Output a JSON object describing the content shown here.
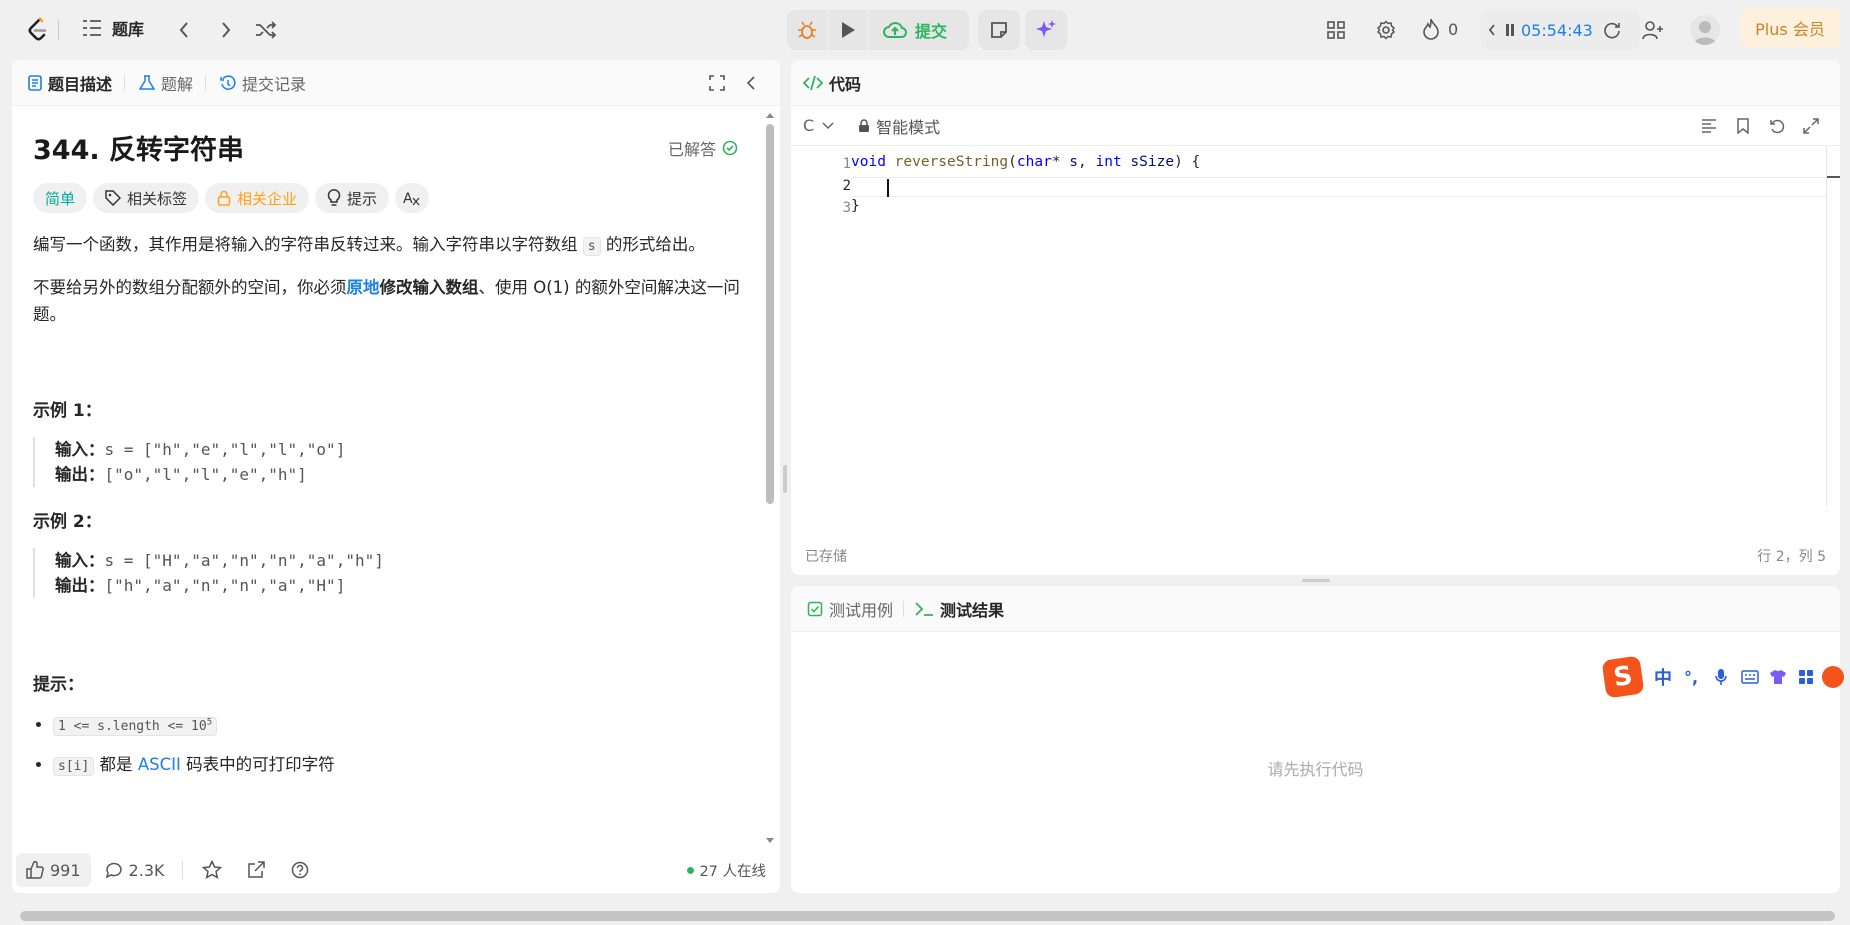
{
  "topbar": {
    "problem_list_label": "题库",
    "submit_label": "提交",
    "streak_count": "0",
    "timer": "05:54:43",
    "plus_label": "Plus 会员"
  },
  "left_panel": {
    "tabs": [
      {
        "label": "题目描述"
      },
      {
        "label": "题解"
      },
      {
        "label": "提交记录"
      }
    ],
    "problem_title": "344. 反转字符串",
    "solved_label": "已解答",
    "tags": {
      "difficulty": "简单",
      "related_tags": "相关标签",
      "related_companies": "相关企业",
      "hint": "提示"
    },
    "desc1_a": "编写一个函数，其作用是将输入的字符串反转过来。输入字符串以字符数组 ",
    "desc1_code": "s",
    "desc1_b": " 的形式给出。",
    "desc2_a": "不要给另外的数组分配额外的空间，你必须",
    "desc2_link": "原地",
    "desc2_bold": "修改输入数组",
    "desc2_b": "、使用 O(1) 的额外空间解决这一问题。",
    "example1_title": "示例 1：",
    "example1_input_label": "输入：",
    "example1_input": "s = [\"h\",\"e\",\"l\",\"l\",\"o\"]",
    "example1_output_label": "输出：",
    "example1_output": "[\"o\",\"l\",\"l\",\"e\",\"h\"]",
    "example2_title": "示例 2：",
    "example2_input_label": "输入：",
    "example2_input": "s = [\"H\",\"a\",\"n\",\"n\",\"a\",\"h\"]",
    "example2_output_label": "输出：",
    "example2_output": "[\"h\",\"a\",\"n\",\"n\",\"a\",\"H\"]",
    "constraints_title": "提示：",
    "constraint1_code": "1 <= s.length <= 10",
    "constraint1_sup": "5",
    "constraint2_code": "s[i]",
    "constraint2_a": " 都是 ",
    "constraint2_link": "ASCII",
    "constraint2_b": " 码表中的可打印字符",
    "footer": {
      "likes": "991",
      "comments": "2.3K",
      "online": "27 人在线"
    }
  },
  "code_panel": {
    "title": "代码",
    "language": "C",
    "mode_label": "智能模式",
    "line_numbers": [
      "1",
      "2",
      "3"
    ],
    "code_line1": {
      "kw": "void",
      "fn": "reverseString",
      "p1": "(",
      "ty1": "char",
      "star": "* ",
      "a1": "s",
      "comma": ", ",
      "ty2": "int",
      "a2": " sSize",
      "p2": ") {"
    },
    "code_line3": "}",
    "saved_label": "已存储",
    "cursor_pos": "行 2，列 5"
  },
  "test_panel": {
    "tabs": [
      {
        "label": "测试用例"
      },
      {
        "label": "测试结果"
      }
    ],
    "placeholder": "请先执行代码"
  },
  "ime_toolbar": {
    "lang": "中",
    "punct": "°,"
  },
  "colors": {
    "accent_green": "#2db55d",
    "easy_teal": "#00af9b",
    "company_orange": "#ffa116",
    "link_blue": "#1a7ff0",
    "plus_bg": "#fdf0dc",
    "plus_text": "#c8862a"
  }
}
